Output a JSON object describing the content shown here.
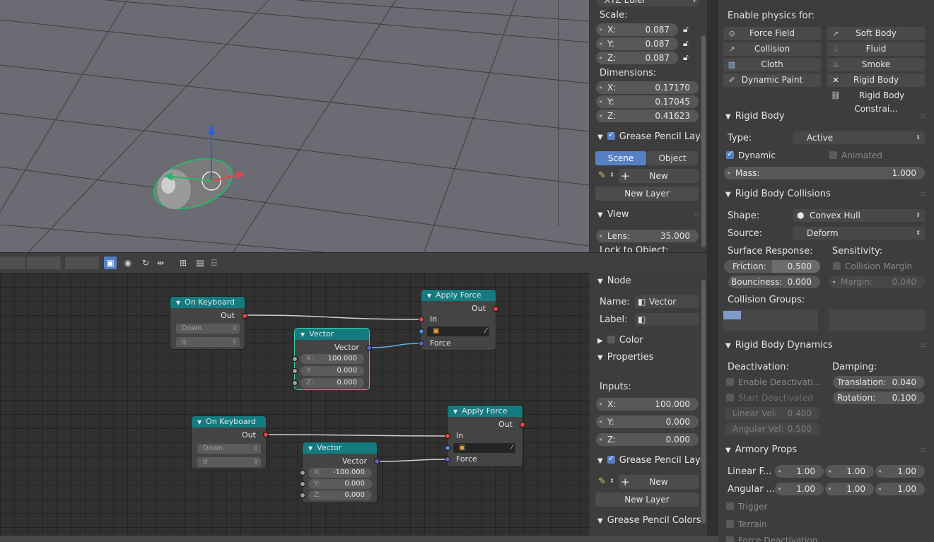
{
  "viewport": {
    "rotation_mode": "XYZ Euler"
  },
  "transform": {
    "scale_label": "Scale:",
    "scale": [
      {
        "axis": "X:",
        "value": "0.087"
      },
      {
        "axis": "Y:",
        "value": "0.087"
      },
      {
        "axis": "Z:",
        "value": "0.087"
      }
    ],
    "dimensions_label": "Dimensions:",
    "dimensions": [
      {
        "axis": "X:",
        "value": "0.17170"
      },
      {
        "axis": "Y:",
        "value": "0.17045"
      },
      {
        "axis": "Z:",
        "value": "0.41623"
      }
    ]
  },
  "grease_top": {
    "title": "Grease Pencil Laye",
    "tab_scene": "Scene",
    "tab_object": "Object",
    "new": "New",
    "new_layer": "New Layer"
  },
  "view": {
    "title": "View",
    "lens_label": "Lens:",
    "lens_value": "35.000",
    "lock": "Lock to Object:"
  },
  "node_panel": {
    "title": "Node",
    "name_label": "Name:",
    "name_value": "Vector",
    "label_label": "Label:",
    "color": "Color",
    "properties": "Properties",
    "inputs": "Inputs:",
    "x": {
      "axis": "X:",
      "value": "100.000"
    },
    "y": {
      "axis": "Y:",
      "value": "0.000"
    },
    "z": {
      "axis": "Z:",
      "value": "0.000"
    },
    "grease_title": "Grease Pencil Laye",
    "new": "New",
    "new_layer": "New Layer",
    "grease_colors": "Grease Pencil Colors"
  },
  "nodes": {
    "kb1": {
      "title": "On Keyboard",
      "out": "Out",
      "event": "Down",
      "key": "q"
    },
    "vec1": {
      "title": "Vector",
      "out": "Vector",
      "x": "X:",
      "xv": "100.000",
      "y": "Y:",
      "yv": "0.000",
      "z": "Z:",
      "zv": "0.000"
    },
    "af1": {
      "title": "Apply Force",
      "out": "Out",
      "in": "In",
      "force": "Force"
    },
    "kb2": {
      "title": "On Keyboard",
      "out": "Out",
      "event": "Down",
      "key": "d"
    },
    "vec2": {
      "title": "Vector",
      "out": "Vector",
      "x": "X:",
      "xv": "-100.000",
      "y": "Y:",
      "yv": "0.000",
      "z": "Z:",
      "zv": "0.000"
    },
    "af2": {
      "title": "Apply Force",
      "out": "Out",
      "in": "In",
      "force": "Force"
    }
  },
  "physics": {
    "enable_label": "Enable physics for:",
    "buttons": [
      "Force Field",
      "Soft Body",
      "Collision",
      "Fluid",
      "Cloth",
      "Smoke",
      "Dynamic Paint",
      "Rigid Body",
      "Rigid Body Constrai..."
    ]
  },
  "rigid_body": {
    "title": "Rigid Body",
    "type_label": "Type:",
    "type_value": "Active",
    "dynamic": "Dynamic",
    "animated": "Animated",
    "mass_label": "Mass:",
    "mass_value": "1.000"
  },
  "collisions": {
    "title": "Rigid Body Collisions",
    "shape_label": "Shape:",
    "shape_value": "Convex Hull",
    "source_label": "Source:",
    "source_value": "Deform",
    "surface": "Surface Response:",
    "sensitivity": "Sensitivity:",
    "friction_label": "Friction:",
    "friction_value": "0.500",
    "bounciness_label": "Bounciness:",
    "bounciness_value": "0.000",
    "collision_margin": "Collision Margin",
    "margin_label": "Margin:",
    "margin_value": "0.040",
    "groups": "Collision Groups:"
  },
  "dynamics": {
    "title": "Rigid Body Dynamics",
    "deactivation": "Deactivation:",
    "damping": "Damping:",
    "enable_deact": "Enable Deactivati...",
    "start_deact": "Start Deactivated",
    "translation_label": "Translation:",
    "translation_value": "0.040",
    "rotation_label": "Rotation:",
    "rotation_value": "0.100",
    "linear_label": "Linear Vel:",
    "linear_value": "0.400",
    "angular_label": "Angular Vel:",
    "angular_value": "0.500"
  },
  "armory": {
    "title": "Armory Props",
    "linear_label": "Linear F...",
    "linear": [
      "1.00",
      "1.00",
      "1.00"
    ],
    "angular_label": "Angular ...",
    "angular": [
      "1.00",
      "1.00",
      "1.00"
    ],
    "trigger": "Trigger",
    "terrain": "Terrain",
    "force_deact": "Force Deactivation"
  },
  "colors": {
    "node_header": "#147b80",
    "selection": "#5680c2",
    "socket_red": "#e24646",
    "socket_purple": "#6363c7",
    "socket_blue": "#4f8ed8"
  }
}
